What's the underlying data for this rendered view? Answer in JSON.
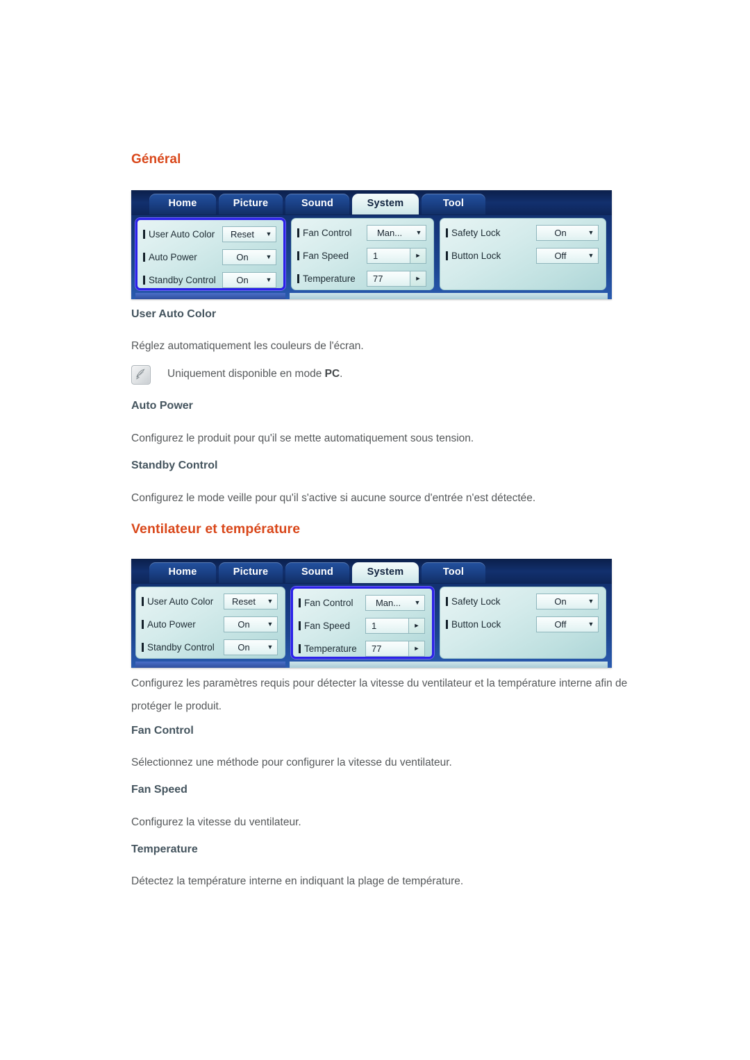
{
  "sections": [
    {
      "heading": "Général",
      "subsections": [
        {
          "title": "User Auto Color",
          "body": "Réglez automatiquement les couleurs de l'écran.",
          "note": {
            "before": "Uniquement disponible en mode ",
            "bold": "PC",
            "after": "."
          }
        },
        {
          "title": "Auto Power",
          "body": "Configurez le produit pour qu'il se mette automatiquement sous tension."
        },
        {
          "title": "Standby Control",
          "body": "Configurez le mode veille pour qu'il s'active si aucune source d'entrée n'est détectée."
        }
      ]
    },
    {
      "heading": "Ventilateur et température",
      "intro_line1": "Configurez les paramètres requis pour détecter la vitesse du ventilateur et la température interne afin de",
      "intro_line2": "protéger le produit.",
      "subsections": [
        {
          "title": "Fan Control",
          "body": "Sélectionnez une méthode pour configurer la vitesse du ventilateur."
        },
        {
          "title": "Fan Speed",
          "body": "Configurez la vitesse du ventilateur."
        },
        {
          "title": "Temperature",
          "body": "Détectez la température interne en indiquant la plage de température."
        }
      ]
    }
  ],
  "osd": {
    "tabs": [
      {
        "label": "Home",
        "active": false
      },
      {
        "label": "Picture",
        "active": false
      },
      {
        "label": "Sound",
        "active": false
      },
      {
        "label": "System",
        "active": true
      },
      {
        "label": "Tool",
        "active": false
      }
    ],
    "panels": {
      "left": {
        "rows": [
          {
            "label": "User Auto Color",
            "value": "Reset",
            "type": "dropdown"
          },
          {
            "label": "Auto Power",
            "value": "On",
            "type": "dropdown"
          },
          {
            "label": "Standby Control",
            "value": "On",
            "type": "dropdown"
          }
        ]
      },
      "middle": {
        "rows": [
          {
            "label": "Fan Control",
            "value": "Man...",
            "type": "dropdown"
          },
          {
            "label": "Fan Speed",
            "value": "1",
            "type": "stepper"
          },
          {
            "label": "Temperature",
            "value": "77",
            "type": "stepper"
          }
        ]
      },
      "right": {
        "rows": [
          {
            "label": "Safety Lock",
            "value": "On",
            "type": "dropdown"
          },
          {
            "label": "Button Lock",
            "value": "Off",
            "type": "dropdown"
          }
        ]
      }
    },
    "caret_glyph": "▼",
    "arrow_glyph": "►",
    "selected_panel_first": "left",
    "selected_panel_second": "middle"
  },
  "colors": {
    "heading": "#d9471a",
    "subheading": "#44545e",
    "body": "#55585a",
    "selection_border": "#2b21e8"
  }
}
